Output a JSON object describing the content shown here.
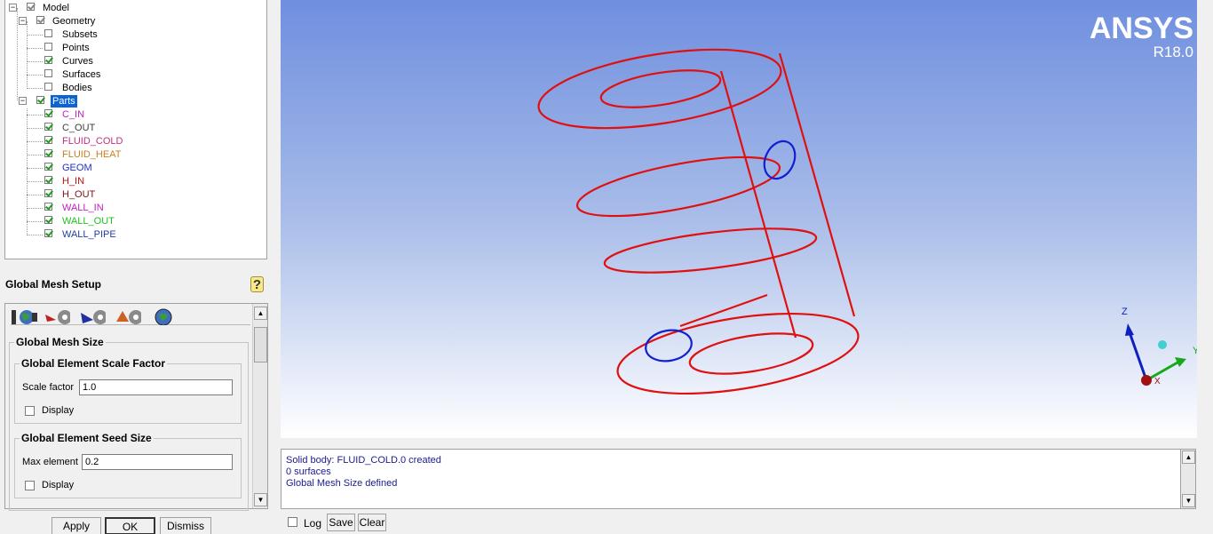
{
  "tree": {
    "root": "Model",
    "geometry": {
      "label": "Geometry",
      "items": [
        {
          "label": "Subsets",
          "checked": false
        },
        {
          "label": "Points",
          "checked": false
        },
        {
          "label": "Curves",
          "checked": true
        },
        {
          "label": "Surfaces",
          "checked": false
        },
        {
          "label": "Bodies",
          "checked": false
        }
      ]
    },
    "parts": {
      "label": "Parts",
      "items": [
        {
          "label": "C_IN",
          "color": "#c020c0"
        },
        {
          "label": "C_OUT",
          "color": "#404040"
        },
        {
          "label": "FLUID_COLD",
          "color": "#c03080"
        },
        {
          "label": "FLUID_HEAT",
          "color": "#c88020"
        },
        {
          "label": "GEOM",
          "color": "#2030c0"
        },
        {
          "label": "H_IN",
          "color": "#c01010"
        },
        {
          "label": "H_OUT",
          "color": "#801010"
        },
        {
          "label": "WALL_IN",
          "color": "#c020c0"
        },
        {
          "label": "WALL_OUT",
          "color": "#20c020"
        },
        {
          "label": "WALL_PIPE",
          "color": "#2040a0"
        }
      ]
    }
  },
  "panel": {
    "title": "Global Mesh Setup",
    "help_icon": "help-icon",
    "icons": [
      "global-mesh-size-icon",
      "shell-meshing-icon",
      "volume-meshing-icon",
      "prism-meshing-icon",
      "periodicity-icon"
    ],
    "size_group": "Global Mesh Size",
    "scale_group": "Global Element Scale Factor",
    "scale_label": "Scale factor",
    "scale_value": "1.0",
    "scale_display": "Display",
    "seed_group": "Global Element Seed Size",
    "max_label": "Max element",
    "max_value": "0.2",
    "seed_display": "Display"
  },
  "buttons": {
    "apply": "Apply",
    "ok": "OK",
    "dismiss": "Dismiss"
  },
  "viewport": {
    "brand": "ANSYS",
    "version": "R18.0",
    "axes": {
      "z": "Z",
      "y": "Y",
      "x": "X"
    }
  },
  "messages": [
    "Solid body: FLUID_COLD.0 created",
    "0 surfaces",
    "Global Mesh Size defined"
  ],
  "bottom": {
    "log_label": "Log",
    "save_label": "Save",
    "clear_label": "Clear"
  },
  "colors": {
    "geometry_red": "#e01010",
    "geometry_blue": "#1020d0",
    "selection": "#0a64d6"
  }
}
